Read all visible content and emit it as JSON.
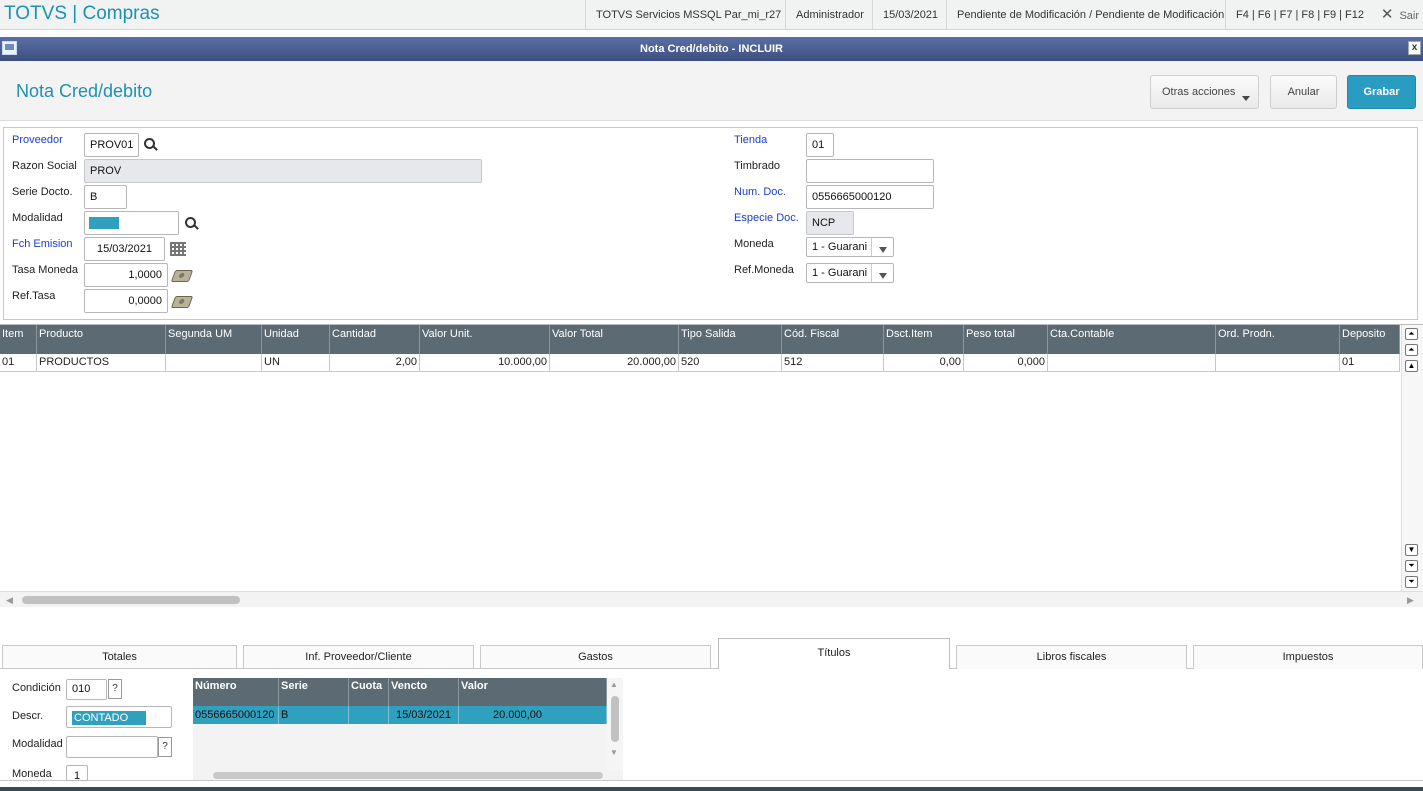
{
  "app": {
    "brand": "TOTVS | Compras"
  },
  "topbar": {
    "environment": "TOTVS Servicios MSSQL Par_mi_r27",
    "user": "Administrador",
    "date": "15/03/2021",
    "status": "Pendiente de Modificación / Pendiente de Modificación",
    "shortcuts": "F4 | F6 | F7 | F8 | F9 | F12",
    "exit_label": "Sair"
  },
  "window": {
    "title": "Nota Cred/debito - INCLUIR",
    "close": "x"
  },
  "header": {
    "title": "Nota Cred/debito",
    "actions": {
      "other": "Otras acciones",
      "cancel": "Anular",
      "save": "Grabar"
    }
  },
  "form": {
    "proveedor": {
      "label": "Proveedor",
      "value": "PROV01"
    },
    "razon_social": {
      "label": "Razon Social",
      "value": "PROV"
    },
    "serie_docto": {
      "label": "Serie Docto.",
      "value": "B"
    },
    "modalidad": {
      "label": "Modalidad",
      "value": ""
    },
    "fch_emision": {
      "label": "Fch Emision",
      "value": "15/03/2021"
    },
    "tasa_moneda": {
      "label": "Tasa Moneda",
      "value": "1,0000"
    },
    "ref_tasa": {
      "label": "Ref.Tasa",
      "value": "0,0000"
    },
    "tienda": {
      "label": "Tienda",
      "value": "01"
    },
    "timbrado": {
      "label": "Timbrado",
      "value": ""
    },
    "num_doc": {
      "label": "Num. Doc.",
      "value": "0556665000120"
    },
    "especie_doc": {
      "label": "Especie Doc.",
      "value": "NCP"
    },
    "moneda": {
      "label": "Moneda",
      "value": "1 - Guarani"
    },
    "ref_moneda": {
      "label": "Ref.Moneda",
      "value": "1 - Guarani"
    }
  },
  "items_grid": {
    "columns": [
      "Item",
      "Producto",
      "Segunda UM",
      "Unidad",
      "Cantidad",
      "Valor Unit.",
      "Valor Total",
      "Tipo Salida",
      "Cód. Fiscal",
      "Dsct.Item",
      "Peso total",
      "Cta.Contable",
      "Ord. Prodn.",
      "Deposito"
    ],
    "rows": [
      [
        "01",
        "PRODUCTOS",
        "",
        "UN",
        "2,00",
        "10.000,00",
        "20.000,00",
        "520",
        "512",
        "0,00",
        "0,000",
        "",
        "",
        "01"
      ]
    ]
  },
  "tabs": [
    {
      "label": "Totales"
    },
    {
      "label": "Inf. Proveedor/Cliente"
    },
    {
      "label": "Gastos"
    },
    {
      "label": "Títulos"
    },
    {
      "label": "Libros fiscales"
    },
    {
      "label": "Impuestos"
    }
  ],
  "titulos": {
    "condicion": {
      "label": "Condición",
      "value": "010",
      "help": "?"
    },
    "descr": {
      "label": "Descr.",
      "value": "CONTADO"
    },
    "modalidad": {
      "label": "Modalidad",
      "value": "",
      "help": "?"
    },
    "moneda": {
      "label": "Moneda",
      "value": "1"
    },
    "grid": {
      "columns": [
        "Número",
        "Serie",
        "Cuota",
        "Vencto",
        "Valor"
      ],
      "rows": [
        [
          "0556665000120",
          "B",
          "",
          "15/03/2021",
          "20.000,00"
        ]
      ]
    }
  },
  "colors": {
    "brand": "#1c91b3",
    "header_bg": "#5c6b73",
    "primary_button": "#2b9cc1",
    "selected_row": "#2fa0bd",
    "required_label": "#1a3ec7"
  }
}
